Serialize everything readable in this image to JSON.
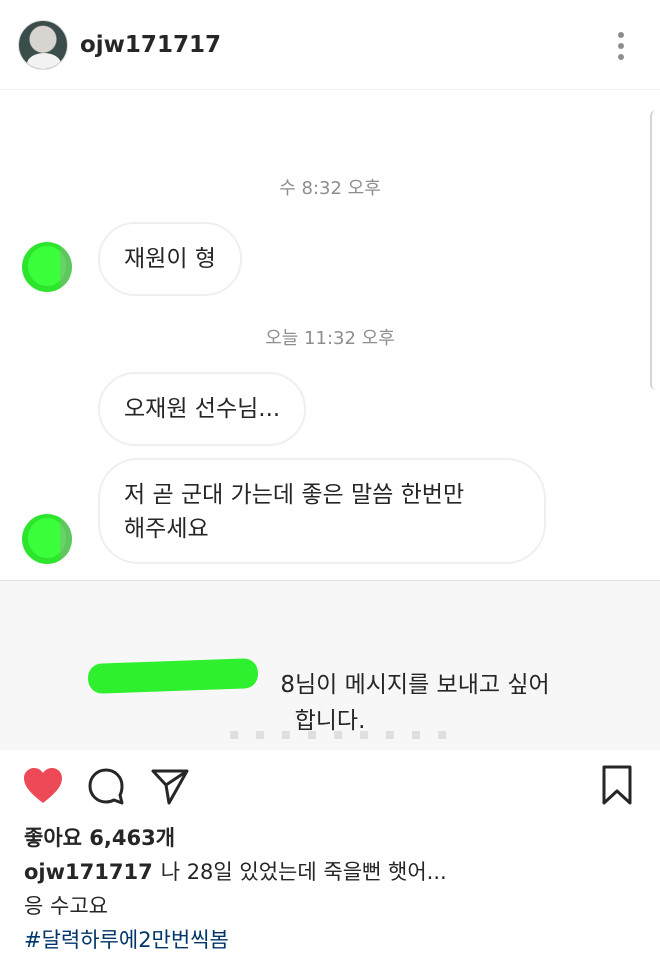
{
  "header": {
    "username": "ojw171717",
    "more_icon": "more-vertical-icon"
  },
  "dm": {
    "messages": [
      {
        "timestamp": "수 8:32 오후",
        "text": "재원이 형"
      },
      {
        "timestamp": "오늘 11:32 오후",
        "text": "오재원 선수님..."
      },
      {
        "line1": "저 곧 군대 가는데 좋은 말씀 한번만",
        "line2": "해주세요"
      }
    ],
    "request": {
      "line1_suffix": "8님이 메시지를 보내고 싶어",
      "line2": "합니다."
    }
  },
  "actions": {
    "icons": [
      "heart-icon",
      "comment-icon",
      "share-icon",
      "bookmark-icon"
    ],
    "liked_color": "#ed4956"
  },
  "post": {
    "likes": "좋아요 6,463개",
    "caption_user": "ojw171717",
    "caption_text": "나 28일 있었는데 죽을뻔 햇어...",
    "caption_line2": "응 수고요",
    "hashtag": "#달력하루에2만번씩봄"
  }
}
